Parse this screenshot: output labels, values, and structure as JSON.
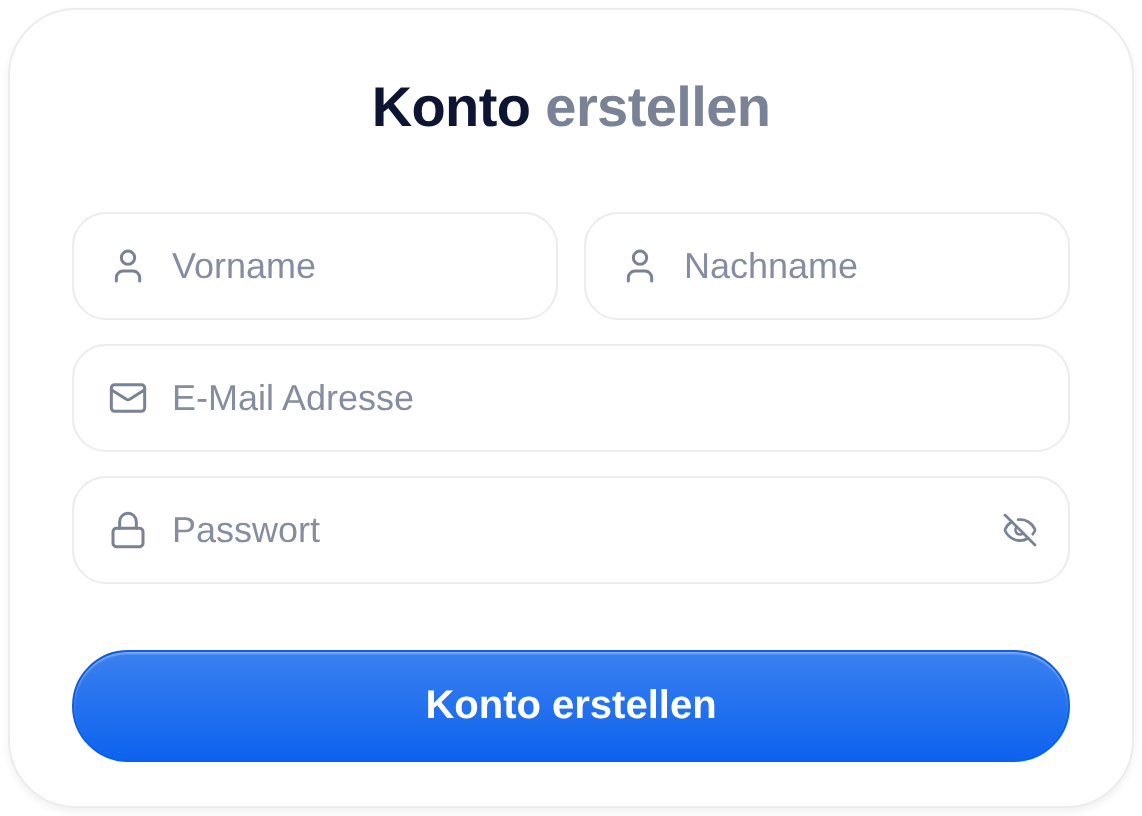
{
  "title": {
    "main": "Konto",
    "accent": "erstellen"
  },
  "field_rows": [
    [
      {
        "kind": "person",
        "placeholder": "Vorname"
      },
      {
        "kind": "person",
        "placeholder": "Nachname"
      }
    ],
    [
      {
        "kind": "mail",
        "placeholder": "E-Mail Adresse"
      }
    ],
    [
      {
        "kind": "lock",
        "placeholder": "Passwort",
        "password_hidden": true
      }
    ]
  ],
  "submit_button": "Konto erstellen"
}
